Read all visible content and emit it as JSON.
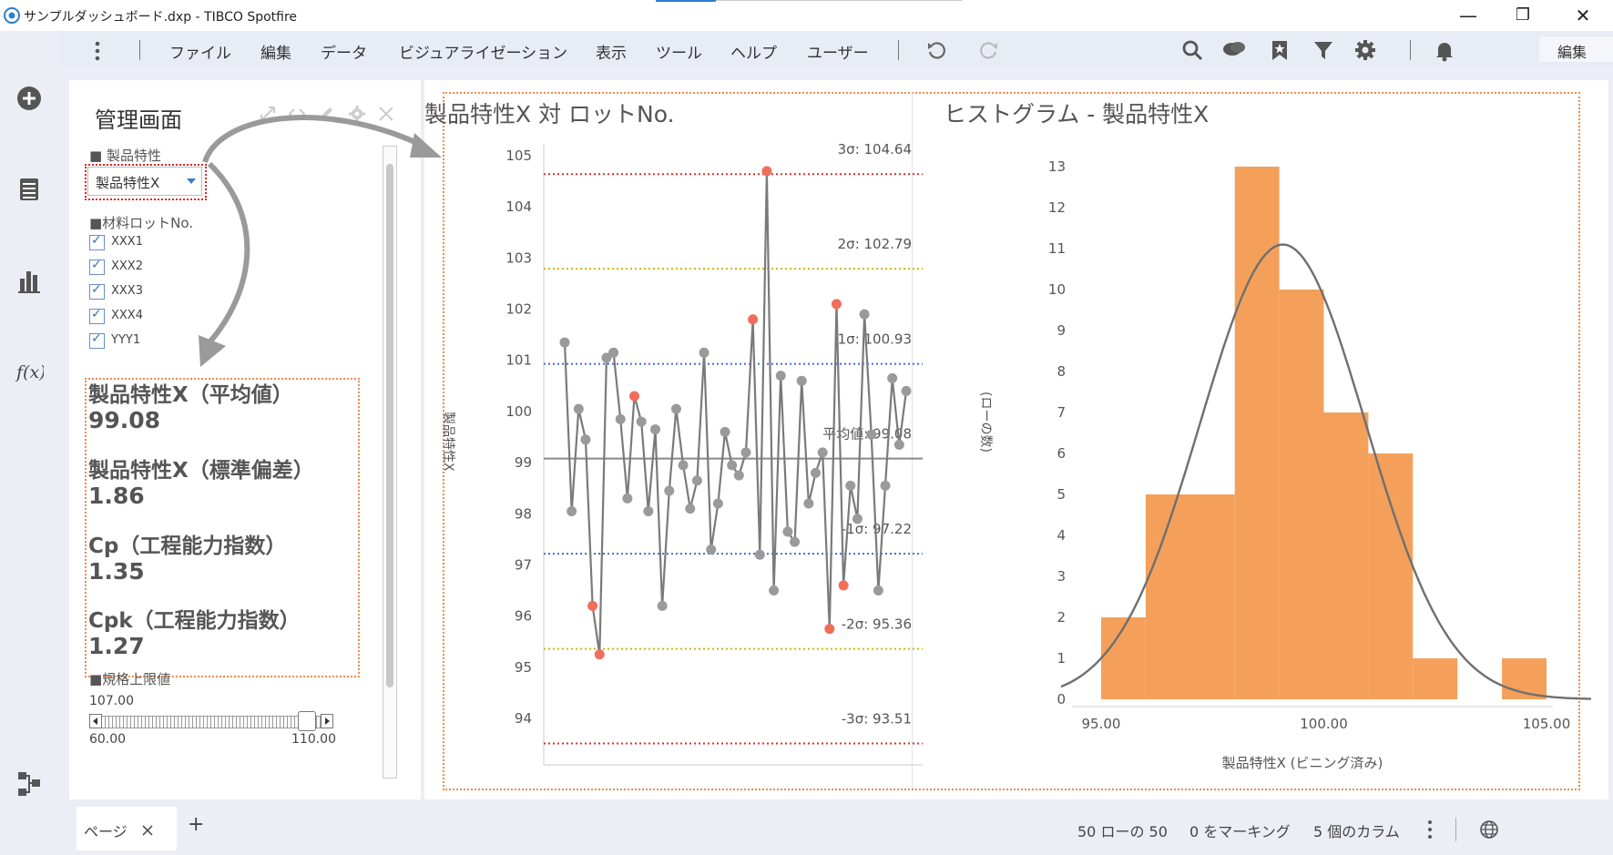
{
  "window": {
    "title": "サンプルダッシュボード.dxp - TIBCO Spotfire",
    "minimize": "—",
    "restore": "❐",
    "close": "✕"
  },
  "menubar": {
    "items": [
      "ファイル",
      "編集",
      "データ",
      "ビジュアライゼーション",
      "表示",
      "ツール",
      "ヘルプ",
      "ユーザー"
    ],
    "mode_select": "編集"
  },
  "text_panel": {
    "title": "管理画面",
    "property_header": "■ 製品特性",
    "property_value": "製品特性X",
    "lot_header": "■材料ロットNo.",
    "lots": [
      "XXX1",
      "XXX2",
      "XXX3",
      "XXX4",
      "YYY1"
    ],
    "kpis": [
      {
        "label": "製品特性X（平均値）",
        "value": "99.08"
      },
      {
        "label": "製品特性X（標準偏差）",
        "value": "1.86"
      },
      {
        "label": "Cp（工程能力指数）",
        "value": "1.35"
      },
      {
        "label": "Cpk（工程能力指数）",
        "value": "1.27"
      }
    ],
    "usl_header": "■規格上限値",
    "usl_value": "107.00",
    "usl_min": "60.00",
    "usl_max": "110.00",
    "usl_fraction": 0.94
  },
  "chart_data": [
    {
      "type": "line",
      "title": "製品特性X 対 ロットNo.",
      "ylabel": "製品特性X",
      "xlabel": "",
      "ylim": [
        93.5,
        105.3
      ],
      "yticks": [
        "105",
        "104",
        "103",
        "102",
        "101",
        "100",
        "99",
        "98",
        "97",
        "96",
        "95",
        "94"
      ],
      "values": [
        101.35,
        98.05,
        100.05,
        99.45,
        96.2,
        95.25,
        101.05,
        101.15,
        99.85,
        98.3,
        100.3,
        99.8,
        98.05,
        99.65,
        96.2,
        98.45,
        100.05,
        98.95,
        98.1,
        98.65,
        101.15,
        97.3,
        98.2,
        99.6,
        98.95,
        98.75,
        99.2,
        101.8,
        97.2,
        104.7,
        96.5,
        100.7,
        97.65,
        97.45,
        100.6,
        98.2,
        98.8,
        99.2,
        95.75,
        102.1,
        96.6,
        98.55,
        97.9,
        101.9,
        99.55,
        96.5,
        98.55,
        100.65,
        99.35,
        100.4
      ],
      "highlight": [
        4,
        5,
        10,
        27,
        29,
        38,
        39,
        40
      ],
      "reference_lines": [
        {
          "label": "3σ: 104.64",
          "value": 104.64,
          "color": "#d9302c"
        },
        {
          "label": "2σ: 102.79",
          "value": 102.79,
          "color": "#d4b40a"
        },
        {
          "label": "1σ: 100.93",
          "value": 100.93,
          "color": "#3f6fd8"
        },
        {
          "label": "平均値: 99.08",
          "value": 99.08,
          "color": "#888888"
        },
        {
          "label": "-1σ: 97.22",
          "value": 97.22,
          "color": "#3f6fd8"
        },
        {
          "label": "-2σ: 95.36",
          "value": 95.36,
          "color": "#d4b40a"
        },
        {
          "label": "-3σ: 93.51",
          "value": 93.51,
          "color": "#d9302c"
        }
      ],
      "colors": {
        "line": "#7a7a7a",
        "point": "#9a9a9a",
        "highlight": "#f06e5a"
      }
    },
    {
      "type": "bar",
      "title": "ヒストグラム - 製品特性X",
      "xlabel": "製品特性X (ビニング済み)",
      "ylabel": "(ローの数)",
      "ylim": [
        0,
        13
      ],
      "yticks": [
        "13",
        "12",
        "11",
        "10",
        "9",
        "8",
        "7",
        "6",
        "5",
        "4",
        "3",
        "2",
        "1",
        "0"
      ],
      "xticks": [
        "95.00",
        "100.00",
        "105.00"
      ],
      "xlim": [
        94.15,
        105.8
      ],
      "bins": [
        {
          "from": 95.0,
          "to": 96.0,
          "count": 2
        },
        {
          "from": 96.0,
          "to": 98.0,
          "count": 5
        },
        {
          "from": 98.0,
          "to": 99.0,
          "count": 13
        },
        {
          "from": 99.0,
          "to": 100.0,
          "count": 10
        },
        {
          "from": 100.0,
          "to": 101.0,
          "count": 7
        },
        {
          "from": 101.0,
          "to": 102.0,
          "count": 6
        },
        {
          "from": 102.0,
          "to": 103.0,
          "count": 1
        },
        {
          "from": 104.0,
          "to": 105.0,
          "count": 1
        }
      ],
      "curve": {
        "mean": 99.08,
        "sd": 1.86,
        "peak": 11.1
      },
      "colors": {
        "bar": "#f5a05a",
        "curve": "#6f6f6f"
      }
    }
  ],
  "statusbar": {
    "page_tab": "ページ",
    "add": "+",
    "rows": "50 ローの 50",
    "marked": "0 をマーキング",
    "columns": "5 個のカラム"
  }
}
